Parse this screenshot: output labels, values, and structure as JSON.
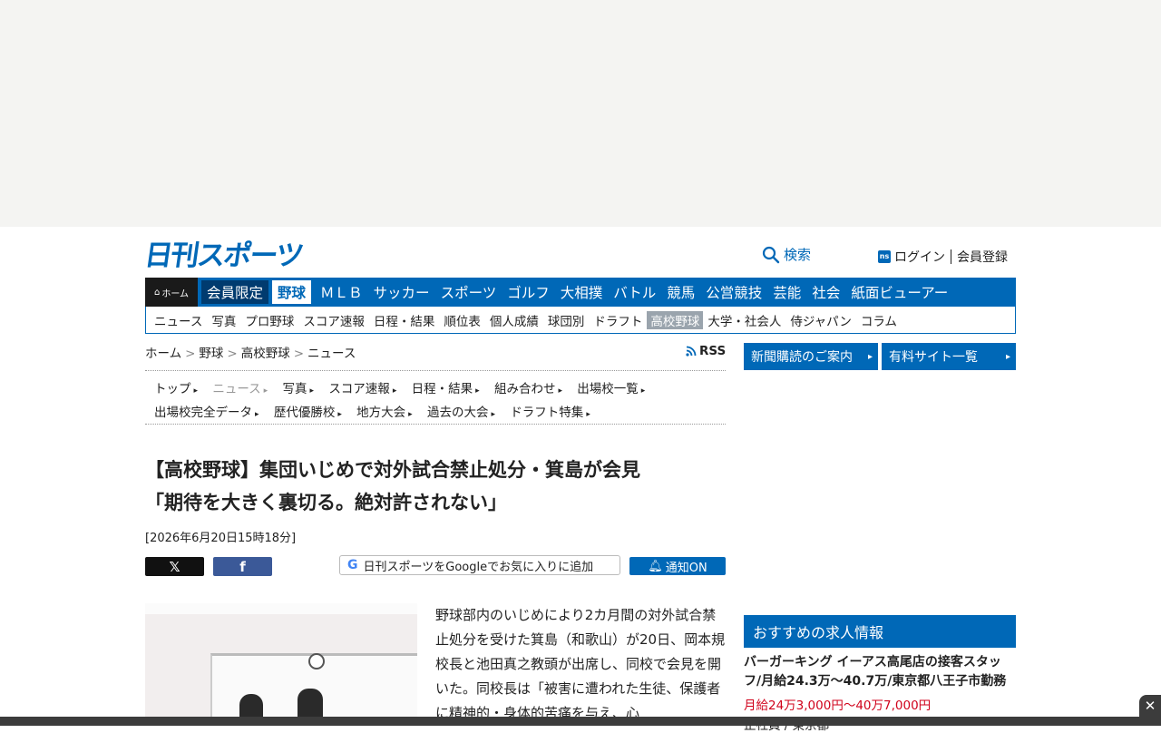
{
  "header": {
    "logo": "日刊スポーツ",
    "search_label": "検索",
    "login_label": "ログイン",
    "register_label": "会員登録"
  },
  "global_nav": {
    "home": "ホーム",
    "items": [
      "会員限定",
      "野球",
      "ＭＬＢ",
      "サッカー",
      "スポーツ",
      "ゴルフ",
      "大相撲",
      "バトル",
      "競馬",
      "公営競技",
      "芸能",
      "社会",
      "紙面ビューアー"
    ],
    "active": "野球"
  },
  "sub_nav": {
    "items": [
      "ニュース",
      "写真",
      "プロ野球",
      "スコア速報",
      "日程・結果",
      "順位表",
      "個人成績",
      "球団別",
      "ドラフト",
      "高校野球",
      "大学・社会人",
      "侍ジャパン",
      "コラム"
    ],
    "active": "高校野球"
  },
  "breadcrumb": [
    "ホーム",
    "野球",
    "高校野球",
    "ニュース"
  ],
  "rss_label": "RSS",
  "category_nav": {
    "row1": [
      "トップ",
      "ニュース",
      "写真",
      "スコア速報",
      "日程・結果",
      "組み合わせ",
      "出場校一覧"
    ],
    "row2": [
      "出場校完全データ",
      "歴代優勝校",
      "地方大会",
      "過去の大会",
      "ドラフト特集"
    ],
    "current": "ニュース"
  },
  "article": {
    "title_line1": "【高校野球】集団いじめで対外試合禁止処分・箕島が会見",
    "title_line2": "「期待を大きく裏切る。絶対許されない」",
    "date": "[2026年6月20日15時18分]",
    "google_follow": "日刊スポーツをGoogleでお気に入りに追加",
    "notify_label": "通知ON",
    "body": "野球部内のいじめにより2カ月間の対外試合禁止処分を受けた箕島（和歌山）が20日、岡本規校長と池田真之教頭が出席し、同校で会見を開いた。同校長は「被害に遭われた生徒、保護者に精神的・身体的苦痛を与え、心"
  },
  "sidebar": {
    "btn_subscribe": "新聞購読のご案内",
    "btn_paid": "有料サイト一覧",
    "jobs_heading": "おすすめの求人情報",
    "job_title": "バーガーキング イーアス高尾店の接客スタッフ/月給24.3万～40.7万/東京都八王子市勤務",
    "job_pay": "月給24万3,000円～40万7,000円",
    "job_type": "正社員 / 東京都"
  },
  "colors": {
    "brand_blue": "#0068b7",
    "pay_red": "#d0021b"
  }
}
